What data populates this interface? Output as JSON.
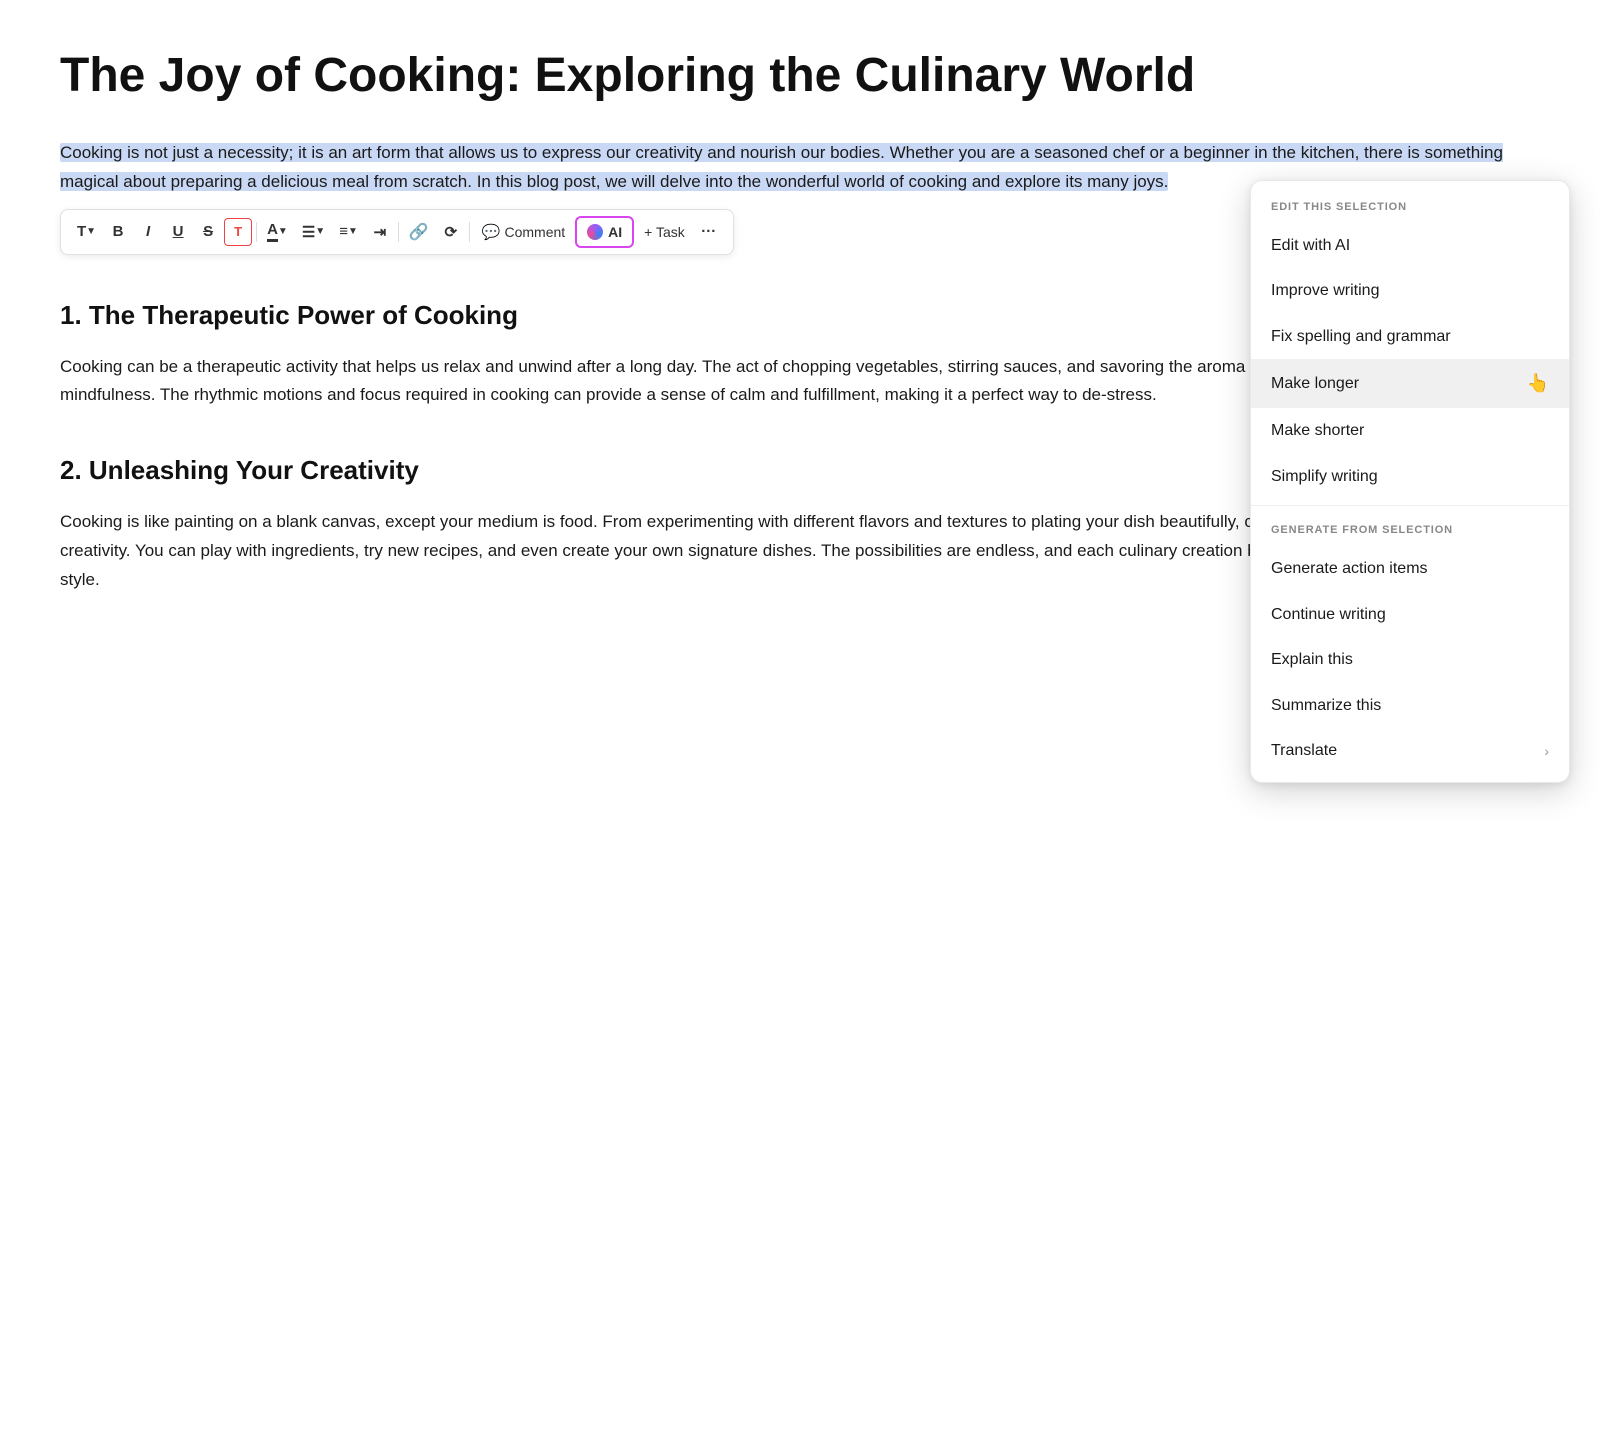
{
  "document": {
    "title": "The Joy of Cooking: Exploring the Culinary World",
    "intro": "Cooking is not just a necessity; it is an art form that allows us to express our creativity and nourish our bodies. Whether you are a seasoned chef or a beginner in the kitchen, there is something magical about preparing a delicious meal from scratch. In this blog post, we will delve into the wonderful world of cooking and explore its many joys.",
    "section1": {
      "heading": "1. The Therapeutic Power of Cooking",
      "body": "Cooking can be a therapeutic activity that helps us relax and unwind after a long day. The act of chopping vegetables, stirring sauces, and savoring the aroma of spices can transport us to a state of mindfulness. The rhythmic motions and focus required in cooking can provide a sense of calm and fulfillment, making it a perfect way to de-stress."
    },
    "section2": {
      "heading": "2. Unleashing Your Creativity",
      "body": "Cooking is like painting on a blank canvas, except your medium is food. From experimenting with different flavors and textures to plating your dish beautifully, cooking allows you to express your creativity. You can play with ingredients, try new recipes, and even create your own signature dishes. The possibilities are endless, and each culinary creation becomes a reflection of your unique style."
    }
  },
  "toolbar": {
    "text_label": "T",
    "bold_label": "B",
    "italic_label": "I",
    "underline_label": "U",
    "strikethrough_label": "S",
    "frame_label": "⊡",
    "font_color_label": "A",
    "align_label": "≡",
    "list_label": "☰",
    "indent_label": "⇥",
    "link_label": "⛓",
    "image_label": "⟳",
    "comment_label": "Comment",
    "ai_label": "AI",
    "task_label": "+ Task",
    "more_label": "···"
  },
  "dropdown": {
    "edit_section_label": "EDIT THIS SELECTION",
    "generate_section_label": "GENERATE FROM SELECTION",
    "items_edit": [
      {
        "id": "edit-with-ai",
        "label": "Edit with AI",
        "has_chevron": false
      },
      {
        "id": "improve-writing",
        "label": "Improve writing",
        "has_chevron": false
      },
      {
        "id": "fix-spelling",
        "label": "Fix spelling and grammar",
        "has_chevron": false
      },
      {
        "id": "make-longer",
        "label": "Make longer",
        "has_chevron": false,
        "highlighted": true
      },
      {
        "id": "make-shorter",
        "label": "Make shorter",
        "has_chevron": false
      },
      {
        "id": "simplify-writing",
        "label": "Simplify writing",
        "has_chevron": false
      }
    ],
    "items_generate": [
      {
        "id": "generate-action-items",
        "label": "Generate action items",
        "has_chevron": false
      },
      {
        "id": "continue-writing",
        "label": "Continue writing",
        "has_chevron": false
      },
      {
        "id": "explain-this",
        "label": "Explain this",
        "has_chevron": false
      },
      {
        "id": "summarize-this",
        "label": "Summarize this",
        "has_chevron": false
      },
      {
        "id": "translate",
        "label": "Translate",
        "has_chevron": true
      }
    ]
  }
}
